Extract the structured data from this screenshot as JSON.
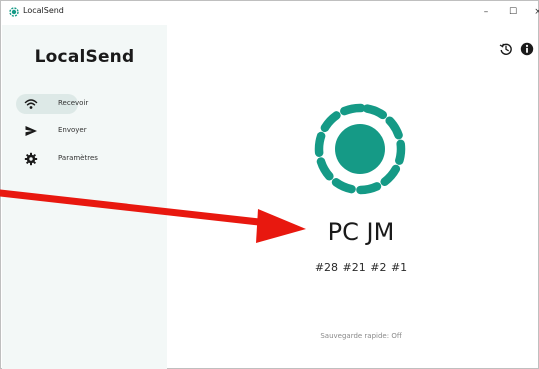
{
  "window": {
    "title": "LocalSend",
    "controls": {
      "minimize": "–",
      "maximize": "☐",
      "close": "×"
    }
  },
  "sidebar": {
    "app_name": "LocalSend",
    "items": [
      {
        "label": "Recevoir",
        "icon": "wifi-icon",
        "active": true
      },
      {
        "label": "Envoyer",
        "icon": "send-icon",
        "active": false
      },
      {
        "label": "Paramètres",
        "icon": "gear-icon",
        "active": false
      }
    ]
  },
  "header": {
    "icons": [
      "history-icon",
      "info-icon"
    ]
  },
  "main": {
    "device_name": "PC JM",
    "device_tags": "#28 #21 #2 #1",
    "quick_save": "Sauvegarde rapide: Off"
  },
  "colors": {
    "accent": "#159a86",
    "sidebar_bg": "#f3f8f7",
    "active_bg": "#dde9e7",
    "annotation_arrow": "#e8180f"
  }
}
